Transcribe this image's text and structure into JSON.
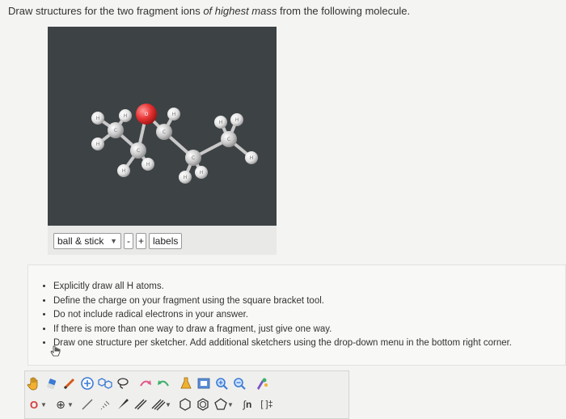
{
  "question": {
    "prefix": "Draw structures for the two fragment ions ",
    "emphasis": "of highest mass",
    "suffix": " from the following molecule."
  },
  "viewer": {
    "atom_labels": {
      "oxygen": "O",
      "carbon": "C",
      "hydrogen": "H"
    },
    "colors": {
      "background": "#3d4245",
      "oxygen": "#e63333",
      "carbon": "#c8c8c8",
      "hydrogen": "#e8e8e8"
    },
    "render_mode": "ball & stick",
    "minus_label": "-",
    "plus_label": "+",
    "labels_button": "labels"
  },
  "instructions": [
    "Explicitly draw all H atoms.",
    "Define the charge on your fragment using the square bracket tool.",
    "Do not include radical electrons in your answer.",
    "If there is more than one way to draw a fragment, just give one way.",
    "Draw one structure per sketcher. Add additional sketchers using the drop-down menu in the bottom right corner."
  ],
  "sketcher": {
    "atom_selector": "O",
    "charge_tool": "⊕",
    "template_tool": "n",
    "bracket_tool": "[ ]‡",
    "icons": [
      "hand-icon",
      "eraser-icon",
      "pencil-icon",
      "plus-charge-icon",
      "rings-icon",
      "lasso-icon",
      "flask-icon",
      "zoom-in-icon",
      "zoom-out-icon",
      "cleanup-icon"
    ]
  }
}
